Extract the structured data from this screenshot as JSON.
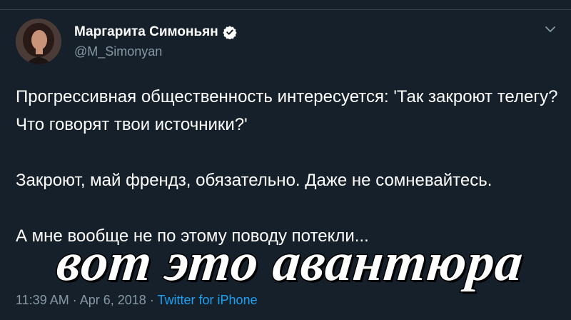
{
  "tweet": {
    "author_name": "Маргарита Симоньян",
    "handle": "@M_Simonyan",
    "paragraphs": [
      "Прогрессивная общественность интересуется: 'Так закроют телегу? Что говорят твои источники?'",
      "Закроют, май френдз, обязательно. Даже не сомневайтесь.",
      "А мне вообще не по этому поводу потекли..."
    ],
    "time": "11:39 AM",
    "date": "Apr 6, 2018",
    "separator": "·",
    "source": "Twitter for iPhone"
  },
  "overlay_caption": "вот это авантюра",
  "icons": {
    "verified": "verified-badge-icon",
    "more": "chevron-down-icon"
  },
  "colors": {
    "background": "#15202b",
    "text": "#ffffff",
    "secondary": "#8899a6",
    "accent": "#1da1f2"
  }
}
